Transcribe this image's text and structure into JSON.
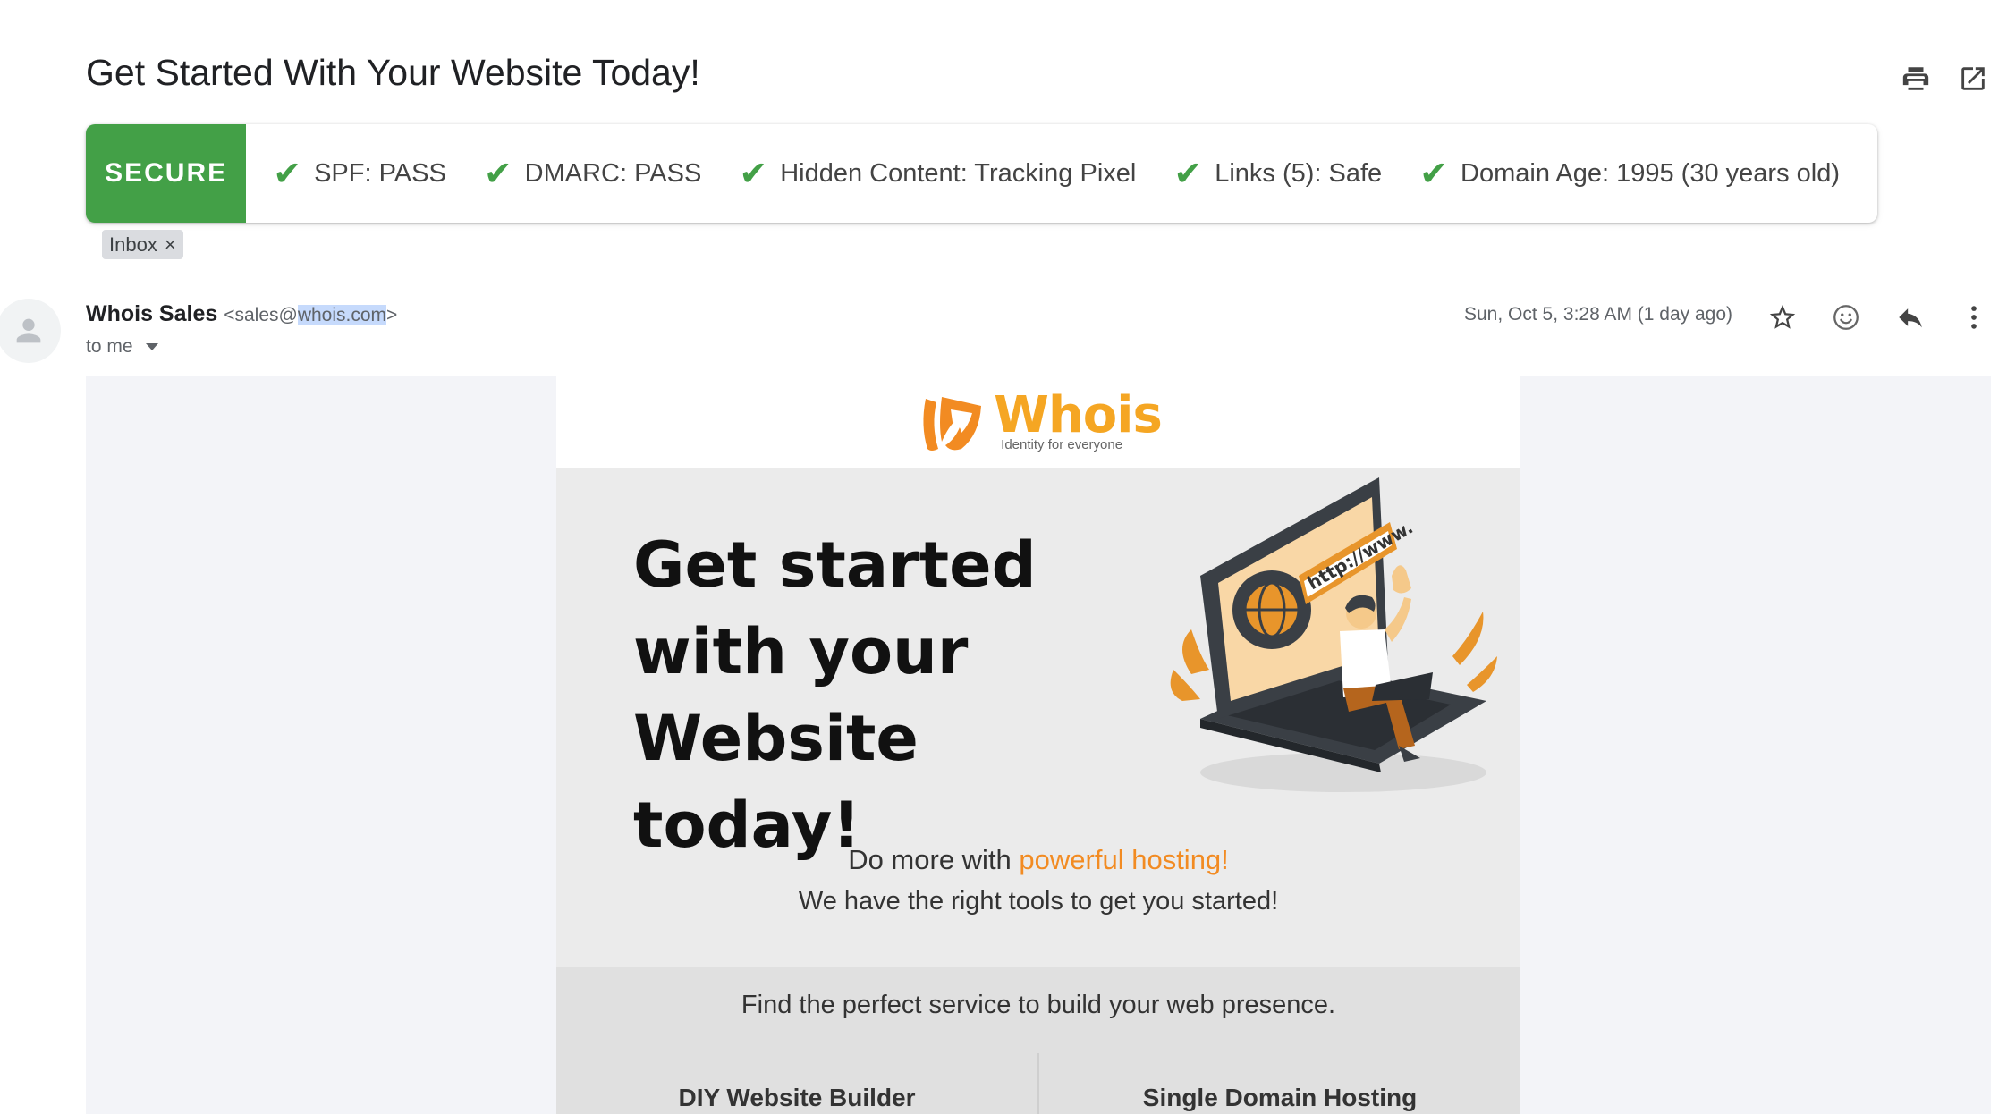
{
  "subject": "Get Started With Your Website Today!",
  "security": {
    "badge": "SECURE",
    "checks": [
      {
        "label": "SPF: PASS"
      },
      {
        "label": "DMARC: PASS"
      },
      {
        "label": "Hidden Content: Tracking Pixel"
      },
      {
        "label": "Links (5): Safe"
      },
      {
        "label": "Domain Age: 1995 (30 years old)"
      }
    ],
    "pass_color": "#43a047"
  },
  "label": {
    "name": "Inbox",
    "remove": "×"
  },
  "sender": {
    "name": "Whois Sales",
    "addr_prefix": "<sales@",
    "addr_highlight": "whois.com",
    "addr_suffix": ">",
    "recipient": "to me"
  },
  "date": "Sun, Oct 5, 3:28 AM (1 day ago)",
  "icons": {
    "print": "print-icon",
    "open_new": "open-in-new-window-icon",
    "star": "star-icon",
    "emoji": "emoji-reaction-icon",
    "reply": "reply-icon",
    "more": "more-vertical-icon"
  },
  "email": {
    "logo_word": "Whois",
    "logo_tagline": "Identity for everyone",
    "hero_title": "Get started with your Website today!",
    "art_url_text": "http://www.",
    "sub_prefix": "Do more with ",
    "sub_accent": "powerful hosting!",
    "sub_line2": "We have the right tools to get you started!",
    "services_intro": "Find the perfect service to build your web presence.",
    "service_left": "DIY Website Builder",
    "service_right": "Single Domain Hosting",
    "accent_color": "#f28b22",
    "brand_color": "#f5a623"
  }
}
